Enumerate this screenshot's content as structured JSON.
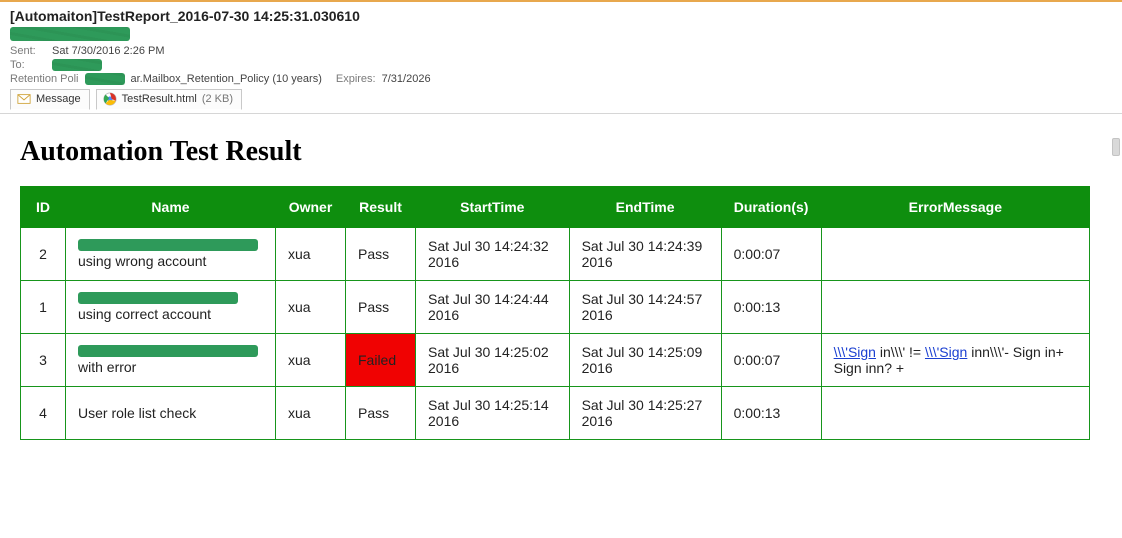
{
  "email": {
    "subject": "[Automaiton]TestReport_2016-07-30 14:25:31.030610",
    "sent_label": "Sent:",
    "sent_value": "Sat 7/30/2016 2:26 PM",
    "to_label": "To:",
    "retention_label": "Retention Poli",
    "retention_value": "ar.Mailbox_Retention_Policy (10 years)",
    "expires_label": "Expires:",
    "expires_value": "7/31/2026"
  },
  "attachments": {
    "message_tab": "Message",
    "file_name": "TestResult.html",
    "file_size": "(2 KB)"
  },
  "report": {
    "title": "Automation Test Result",
    "headers": {
      "id": "ID",
      "name": "Name",
      "owner": "Owner",
      "result": "Result",
      "start": "StartTime",
      "end": "EndTime",
      "duration": "Duration(s)",
      "error": "ErrorMessage"
    },
    "rows": [
      {
        "id": "2",
        "name_suffix": "using wrong account",
        "owner": "xua",
        "result": "Pass",
        "start": "Sat Jul 30 14:24:32 2016",
        "end": "Sat Jul 30 14:24:39 2016",
        "duration": "0:00:07",
        "error": ""
      },
      {
        "id": "1",
        "name_suffix": "using correct account",
        "owner": "xua",
        "result": "Pass",
        "start": "Sat Jul 30 14:24:44 2016",
        "end": "Sat Jul 30 14:24:57 2016",
        "duration": "0:00:13",
        "error": ""
      },
      {
        "id": "3",
        "name_suffix": "with error",
        "owner": "xua",
        "result": "Failed",
        "start": "Sat Jul 30 14:25:02 2016",
        "end": "Sat Jul 30 14:25:09 2016",
        "duration": "0:00:07",
        "error_link1": "\\\\\\'Sign",
        "error_mid1": " in\\\\\\' != ",
        "error_link2": "\\\\\\'Sign",
        "error_tail": " inn\\\\\\'- Sign in+ Sign inn? +"
      },
      {
        "id": "4",
        "name_suffix": "User role list check",
        "owner": "xua",
        "result": "Pass",
        "start": "Sat Jul 30 14:25:14 2016",
        "end": "Sat Jul 30 14:25:27 2016",
        "duration": "0:00:13",
        "error": ""
      }
    ]
  }
}
